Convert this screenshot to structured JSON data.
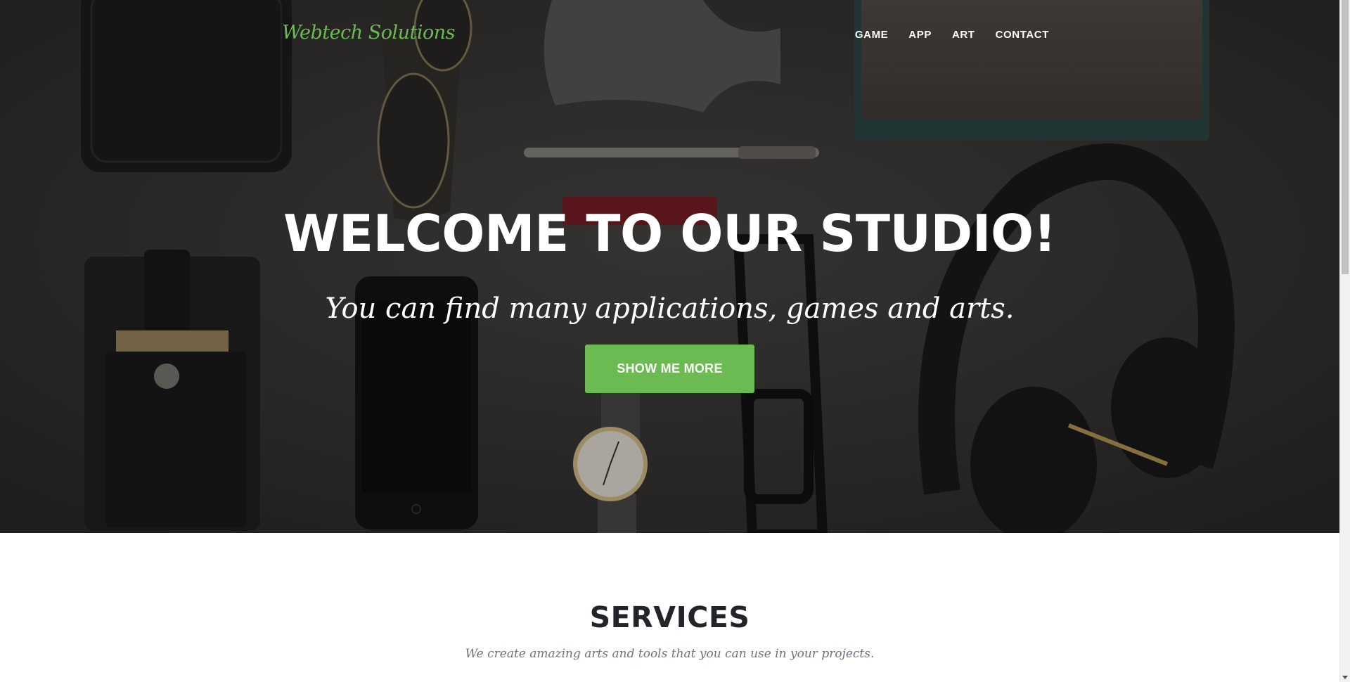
{
  "navbar": {
    "brand": "Webtech Solutions",
    "links": [
      {
        "label": "GAME"
      },
      {
        "label": "APP"
      },
      {
        "label": "ART"
      },
      {
        "label": "CONTACT"
      }
    ]
  },
  "hero": {
    "title": "WELCOME TO OUR STUDIO!",
    "subtitle": "You can find many applications, games and arts.",
    "button_label": "SHOW ME MORE"
  },
  "services": {
    "heading": "SERVICES",
    "subheading": "We create amazing arts and tools that you can use in your projects."
  },
  "colors": {
    "accent": "#6cbb52",
    "hero_bg": "#3a3837",
    "heading_text": "#212529",
    "muted_text": "#6c757d"
  },
  "icons": {
    "scroll_down": "chevron-down-icon"
  }
}
